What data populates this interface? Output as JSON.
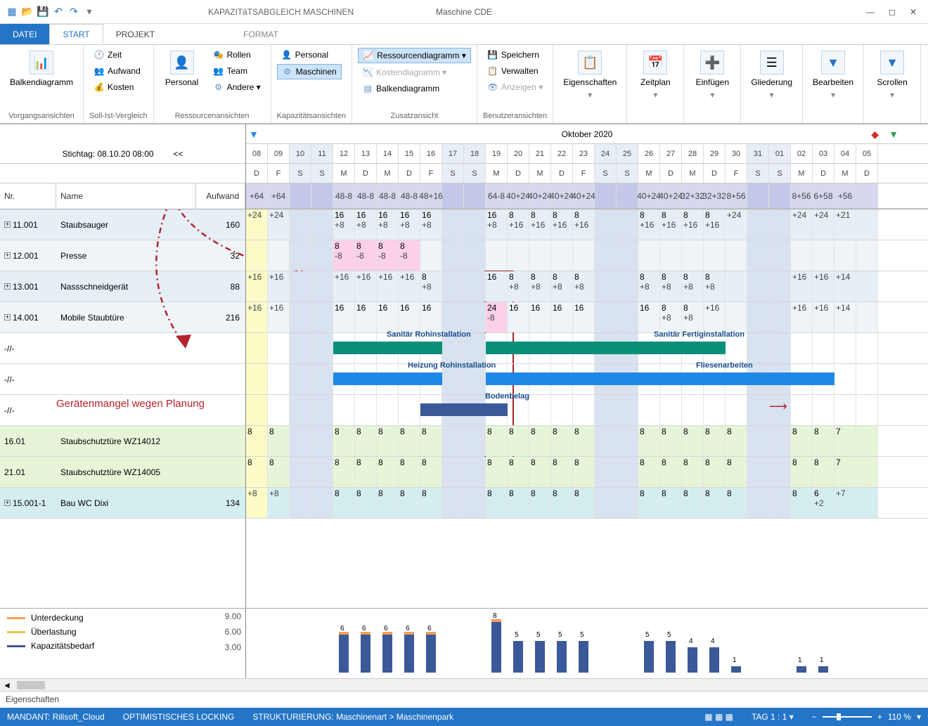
{
  "title": {
    "context": "KAPAZITäTSABGLEICH MASCHINEN",
    "doc": "Maschine CDE"
  },
  "qat": {
    "icons": [
      "app",
      "open",
      "save",
      "undo",
      "redo",
      "dropdown"
    ]
  },
  "tabs": {
    "datei": "DATEI",
    "start": "START",
    "projekt": "PROJEKT",
    "format": "FORMAT"
  },
  "ribbon": {
    "g1": {
      "btn": "Balkendiagramm",
      "sub": "▾",
      "cap": "Vorgangsansichten"
    },
    "g2": {
      "items": [
        "Zeit",
        "Aufwand",
        "Kosten"
      ],
      "cap": "Soll-Ist-Vergleich"
    },
    "g3": {
      "btn": "Personal",
      "items": [
        "Rollen",
        "Team",
        "Andere ▾"
      ],
      "cap": "Ressourcenansichten"
    },
    "g4": {
      "items": [
        "Personal",
        "Maschinen"
      ],
      "cap": "Kapazitätsansichten"
    },
    "g5": {
      "items": [
        "Ressourcendiagramm ▾",
        "Kostendiagramm ▾",
        "Balkendiagramm"
      ],
      "cap": "Zusatzansicht"
    },
    "g6": {
      "items": [
        "Speichern",
        "Verwalten",
        "Anzeigen ▾"
      ],
      "cap": "Benutzeransichten"
    },
    "g7": {
      "btn": "Eigenschaften",
      "cap": ""
    },
    "g8": {
      "btn": "Zeitplan",
      "cap": ""
    },
    "g9": {
      "btn": "Einfügen",
      "cap": ""
    },
    "g10": {
      "btn": "Gliederung",
      "cap": ""
    },
    "g11": {
      "btn": "Bearbeiten",
      "cap": ""
    },
    "g12": {
      "btn": "Scrollen",
      "cap": ""
    }
  },
  "timeline": {
    "month": "Oktober 2020",
    "stichtag": "Stichtag: 08.10.20 08:00",
    "navprev": "<<",
    "days": [
      "08",
      "09",
      "10",
      "11",
      "12",
      "13",
      "14",
      "15",
      "16",
      "17",
      "18",
      "19",
      "20",
      "21",
      "22",
      "23",
      "24",
      "25",
      "26",
      "27",
      "28",
      "29",
      "30",
      "31",
      "01",
      "02",
      "03",
      "04",
      "05"
    ],
    "wk": [
      "D",
      "F",
      "S",
      "S",
      "M",
      "D",
      "M",
      "D",
      "F",
      "S",
      "S",
      "M",
      "D",
      "M",
      "D",
      "F",
      "S",
      "S",
      "M",
      "D",
      "M",
      "D",
      "F",
      "S",
      "S",
      "M",
      "D",
      "M",
      "D"
    ],
    "cols": {
      "nr": "Nr.",
      "name": "Name",
      "aufwand": "Aufwand"
    }
  },
  "rows": [
    {
      "kind": "sum",
      "nr": "",
      "name": "",
      "af": "",
      "cells": [
        [
          "",
          "+64"
        ],
        [
          "",
          "+64"
        ],
        [
          "",
          ""
        ],
        [
          "",
          ""
        ],
        [
          "48",
          "-8"
        ],
        [
          "48",
          "-8"
        ],
        [
          "48",
          "-8"
        ],
        [
          "48",
          "-8"
        ],
        [
          "48",
          "+16"
        ],
        [
          "",
          ""
        ],
        [
          "",
          ""
        ],
        [
          "64",
          "-8"
        ],
        [
          "40",
          "+24"
        ],
        [
          "40",
          "+24"
        ],
        [
          "40",
          "+24"
        ],
        [
          "40",
          "+24"
        ],
        [
          "",
          ""
        ],
        [
          "",
          ""
        ],
        [
          "40",
          "+24"
        ],
        [
          "40",
          "+24"
        ],
        [
          "32",
          "+32"
        ],
        [
          "32",
          "+32"
        ],
        [
          "8",
          "+56"
        ],
        [
          "",
          ""
        ],
        [
          "",
          ""
        ],
        [
          "8",
          "+56"
        ],
        [
          "6",
          "+58"
        ],
        [
          "",
          "+56"
        ],
        [
          "",
          ""
        ]
      ]
    },
    {
      "kind": "r1",
      "nr": "11.001",
      "name": "Staubsauger",
      "af": "160",
      "exp": true,
      "cells": [
        [
          "",
          "+24"
        ],
        [
          "",
          "+24"
        ],
        [
          "",
          ""
        ],
        [
          "",
          ""
        ],
        [
          "16",
          "+8"
        ],
        [
          "16",
          "+8"
        ],
        [
          "16",
          "+8"
        ],
        [
          "16",
          "+8"
        ],
        [
          "16",
          "+8"
        ],
        [
          "",
          ""
        ],
        [
          "",
          ""
        ],
        [
          "16",
          "+8"
        ],
        [
          "8",
          "+16"
        ],
        [
          "8",
          "+16"
        ],
        [
          "8",
          "+16"
        ],
        [
          "8",
          "+16"
        ],
        [
          "",
          ""
        ],
        [
          "",
          ""
        ],
        [
          "8",
          "+16"
        ],
        [
          "8",
          "+16"
        ],
        [
          "8",
          "+16"
        ],
        [
          "8",
          "+16"
        ],
        [
          "",
          "+24"
        ],
        [
          "",
          ""
        ],
        [
          "",
          ""
        ],
        [
          "",
          "+24"
        ],
        [
          "",
          "+24"
        ],
        [
          "",
          "+21"
        ],
        [
          "",
          ""
        ]
      ]
    },
    {
      "kind": "r2",
      "nr": "12.001",
      "name": "Presse",
      "af": "32",
      "exp": true,
      "cells": [
        [
          "",
          ""
        ],
        [
          "",
          ""
        ],
        [
          "",
          ""
        ],
        [
          "",
          ""
        ],
        [
          "8",
          "-8",
          "hl"
        ],
        [
          "8",
          "-8",
          "hl"
        ],
        [
          "8",
          "-8",
          "hl"
        ],
        [
          "8",
          "-8",
          "hl"
        ],
        [
          "",
          ""
        ],
        [
          "",
          ""
        ],
        [
          "",
          ""
        ],
        [
          "",
          ""
        ],
        [
          "",
          ""
        ],
        [
          "",
          ""
        ],
        [
          "",
          ""
        ],
        [
          "",
          ""
        ],
        [
          "",
          ""
        ],
        [
          "",
          ""
        ],
        [
          "",
          ""
        ],
        [
          "",
          ""
        ],
        [
          "",
          ""
        ],
        [
          "",
          ""
        ],
        [
          "",
          ""
        ],
        [
          "",
          ""
        ],
        [
          "",
          ""
        ],
        [
          "",
          ""
        ],
        [
          "",
          ""
        ],
        [
          "",
          ""
        ],
        [
          "",
          ""
        ]
      ]
    },
    {
      "kind": "r1",
      "nr": "13.001",
      "name": "Nassschneidgerät",
      "af": "88",
      "exp": true,
      "cells": [
        [
          "",
          "+16"
        ],
        [
          "",
          "+16"
        ],
        [
          "",
          ""
        ],
        [
          "",
          ""
        ],
        [
          "",
          "+16"
        ],
        [
          "",
          "+16"
        ],
        [
          "",
          "+16"
        ],
        [
          "",
          "+16"
        ],
        [
          "8",
          "+8"
        ],
        [
          "",
          ""
        ],
        [
          "",
          ""
        ],
        [
          "16",
          ""
        ],
        [
          "8",
          "+8"
        ],
        [
          "8",
          "+8"
        ],
        [
          "8",
          "+8"
        ],
        [
          "8",
          "+8"
        ],
        [
          "",
          ""
        ],
        [
          "",
          ""
        ],
        [
          "8",
          "+8"
        ],
        [
          "8",
          "+8"
        ],
        [
          "8",
          "+8"
        ],
        [
          "8",
          "+8"
        ],
        [
          "",
          ""
        ],
        [
          "",
          ""
        ],
        [
          "",
          ""
        ],
        [
          "",
          "+16"
        ],
        [
          "",
          "+16"
        ],
        [
          "",
          "+14"
        ],
        [
          "",
          ""
        ]
      ]
    },
    {
      "kind": "r2",
      "nr": "14.001",
      "name": "Mobile Staubtüre",
      "af": "216",
      "exp": true,
      "cells": [
        [
          "",
          "+16"
        ],
        [
          "",
          "+16"
        ],
        [
          "",
          ""
        ],
        [
          "",
          ""
        ],
        [
          "16",
          ""
        ],
        [
          "16",
          ""
        ],
        [
          "16",
          ""
        ],
        [
          "16",
          ""
        ],
        [
          "16",
          ""
        ],
        [
          "",
          ""
        ],
        [
          "",
          ""
        ],
        [
          "24",
          "-8",
          "hl"
        ],
        [
          "16",
          ""
        ],
        [
          "16",
          ""
        ],
        [
          "16",
          ""
        ],
        [
          "16",
          ""
        ],
        [
          "",
          ""
        ],
        [
          "",
          ""
        ],
        [
          "16",
          ""
        ],
        [
          "8",
          "+8"
        ],
        [
          "8",
          "+8"
        ],
        [
          "",
          "+16"
        ],
        [
          "",
          ""
        ],
        [
          "",
          ""
        ],
        [
          "",
          ""
        ],
        [
          "",
          "+16"
        ],
        [
          "",
          "+16"
        ],
        [
          "",
          "+14"
        ],
        [
          "",
          ""
        ]
      ]
    },
    {
      "kind": "task",
      "nr": "-//-",
      "name": "",
      "af": "",
      "bars": [
        {
          "cls": "teal",
          "from": 4,
          "to": 9,
          "lbl": "Sanitär Rohinstallation",
          "lblx": 200
        },
        {
          "cls": "teal",
          "from": 11,
          "to": 22,
          "lbl": "Sanitär Fertiginstallation",
          "lblx": 580
        }
      ]
    },
    {
      "kind": "task",
      "nr": "-//-",
      "name": "",
      "af": "",
      "bars": [
        {
          "cls": "blue",
          "from": 4,
          "to": 9,
          "lbl": "Heizung Rohinstallation",
          "lblx": 230
        },
        {
          "cls": "blue",
          "from": 11,
          "to": 27,
          "lbl": "Fliesenarbeiten",
          "lblx": 640,
          "arrow": true
        }
      ]
    },
    {
      "kind": "task",
      "nr": "-//-",
      "name": "",
      "af": "",
      "bars": [
        {
          "cls": "dblue",
          "from": 8,
          "to": 12,
          "lbl": "Bodenbelag",
          "lblx": 340
        }
      ]
    },
    {
      "kind": "grn",
      "nr": "16.01",
      "name": "Staubschutztüre WZ14012",
      "af": "",
      "cells": [
        [
          "8",
          ""
        ],
        [
          "8",
          ""
        ],
        [
          "",
          ""
        ],
        [
          "",
          ""
        ],
        [
          "8",
          ""
        ],
        [
          "8",
          ""
        ],
        [
          "8",
          ""
        ],
        [
          "8",
          ""
        ],
        [
          "8",
          ""
        ],
        [
          "",
          ""
        ],
        [
          "",
          ""
        ],
        [
          "8",
          ""
        ],
        [
          "8",
          ""
        ],
        [
          "8",
          ""
        ],
        [
          "8",
          ""
        ],
        [
          "8",
          ""
        ],
        [
          "",
          ""
        ],
        [
          "",
          ""
        ],
        [
          "8",
          ""
        ],
        [
          "8",
          ""
        ],
        [
          "8",
          ""
        ],
        [
          "8",
          ""
        ],
        [
          "8",
          ""
        ],
        [
          "",
          ""
        ],
        [
          "",
          ""
        ],
        [
          "8",
          ""
        ],
        [
          "8",
          ""
        ],
        [
          "7",
          ""
        ],
        [
          "",
          ""
        ]
      ]
    },
    {
      "kind": "grn",
      "nr": "21.01",
      "name": "Staubschutztüre WZ14005",
      "af": "",
      "cells": [
        [
          "8",
          ""
        ],
        [
          "8",
          ""
        ],
        [
          "",
          ""
        ],
        [
          "",
          ""
        ],
        [
          "8",
          ""
        ],
        [
          "8",
          ""
        ],
        [
          "8",
          ""
        ],
        [
          "8",
          ""
        ],
        [
          "8",
          ""
        ],
        [
          "",
          ""
        ],
        [
          "",
          ""
        ],
        [
          "8",
          ""
        ],
        [
          "8",
          ""
        ],
        [
          "8",
          ""
        ],
        [
          "8",
          ""
        ],
        [
          "8",
          ""
        ],
        [
          "",
          ""
        ],
        [
          "",
          ""
        ],
        [
          "8",
          ""
        ],
        [
          "8",
          ""
        ],
        [
          "8",
          ""
        ],
        [
          "8",
          ""
        ],
        [
          "8",
          ""
        ],
        [
          "",
          ""
        ],
        [
          "",
          ""
        ],
        [
          "8",
          ""
        ],
        [
          "8",
          ""
        ],
        [
          "7",
          ""
        ],
        [
          "",
          ""
        ]
      ]
    },
    {
      "kind": "last",
      "nr": "15.001-1",
      "name": "Bau WC Dixi",
      "af": "134",
      "exp": true,
      "cells": [
        [
          "",
          "+8"
        ],
        [
          "",
          "+8"
        ],
        [
          "",
          ""
        ],
        [
          "",
          ""
        ],
        [
          "8",
          ""
        ],
        [
          "8",
          ""
        ],
        [
          "8",
          ""
        ],
        [
          "8",
          ""
        ],
        [
          "8",
          ""
        ],
        [
          "",
          ""
        ],
        [
          "",
          ""
        ],
        [
          "8",
          ""
        ],
        [
          "8",
          ""
        ],
        [
          "8",
          ""
        ],
        [
          "8",
          ""
        ],
        [
          "8",
          ""
        ],
        [
          "",
          ""
        ],
        [
          "",
          ""
        ],
        [
          "8",
          ""
        ],
        [
          "8",
          ""
        ],
        [
          "8",
          ""
        ],
        [
          "8",
          ""
        ],
        [
          "8",
          ""
        ],
        [
          "",
          ""
        ],
        [
          "",
          ""
        ],
        [
          "8",
          ""
        ],
        [
          "6",
          "+2"
        ],
        [
          "",
          "+7"
        ],
        [
          "",
          ""
        ]
      ]
    }
  ],
  "chart": {
    "legend": [
      {
        "c": "#f2a05a",
        "t": "Unterdeckung"
      },
      {
        "c": "#e6c84a",
        "t": "Überlastung"
      },
      {
        "c": "#3b5998",
        "t": "Kapazitätsbedarf"
      }
    ],
    "yticks": [
      "9.00",
      "6.00",
      "3.00"
    ],
    "bars": [
      {
        "d": 4,
        "v": 6,
        "ov": 1
      },
      {
        "d": 5,
        "v": 6,
        "ov": 1
      },
      {
        "d": 6,
        "v": 6,
        "ov": 1
      },
      {
        "d": 7,
        "v": 6,
        "ov": 1
      },
      {
        "d": 8,
        "v": 6,
        "ov": 1
      },
      {
        "d": 11,
        "v": 8,
        "ov": 1
      },
      {
        "d": 12,
        "v": 5
      },
      {
        "d": 13,
        "v": 5
      },
      {
        "d": 14,
        "v": 5
      },
      {
        "d": 15,
        "v": 5
      },
      {
        "d": 18,
        "v": 5
      },
      {
        "d": 19,
        "v": 5
      },
      {
        "d": 20,
        "v": 4
      },
      {
        "d": 21,
        "v": 4
      },
      {
        "d": 22,
        "v": 1
      },
      {
        "d": 25,
        "v": 1
      },
      {
        "d": 26,
        "v": 1
      }
    ]
  },
  "annotations": {
    "mangel": "Gerätenmangel wegen Planung"
  },
  "props": "Eigenschaften",
  "status": {
    "mandant": "MANDANT: Rillsoft_Cloud",
    "lock": "OPTIMISTISCHES LOCKING",
    "struct": "STRUKTURIERUNG: Maschinenart > Maschinenpark",
    "scale": "TAG 1 : 1 ▾",
    "zoom": "110 %"
  }
}
